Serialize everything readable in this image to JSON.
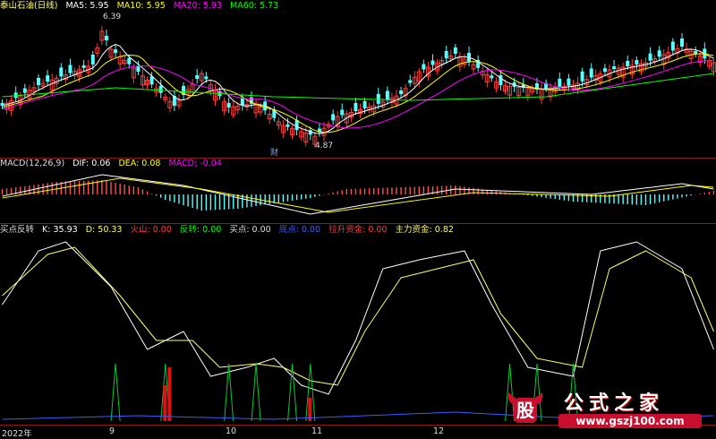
{
  "top_panel": {
    "stock_name": "泰山石油(日线)",
    "ma5": "MA5: 5.95",
    "ma10": "MA10: 5.95",
    "ma20": "MA20: 5.93",
    "ma60": "MA60: 5.73",
    "high_label": "6.39",
    "low_label": "4.87",
    "event_marker": "财",
    "colors": {
      "up": "#ff3b3b",
      "down": "#54ffff",
      "ma5": "#ffffff",
      "ma10": "#ffff00",
      "ma20": "#ff00ff",
      "ma60": "#00ff00"
    }
  },
  "macd_panel": {
    "title": "MACD(12,26,9)",
    "dif": "DIF: 0.06",
    "dea": "DEA: 0.08",
    "macd": "MACD: -0.04"
  },
  "indicator_panel": {
    "title": "买点反转",
    "k": "K: 35.93",
    "d": "D: 50.33",
    "huoshan": "火山: 0.00",
    "fanzhuan": "反转: 0.00",
    "maidian": "买点: 0.00",
    "jiedian": "底点: 0.00",
    "lasheng": "拉升资金: 0.00",
    "zhuli": "主力资金: 0.82"
  },
  "x_axis": {
    "labels": [
      "2022年",
      "9",
      "10",
      "11",
      "12"
    ]
  },
  "watermark": {
    "title": "公式之家",
    "url": "www.gszj100.com",
    "badge_char": "股"
  }
}
